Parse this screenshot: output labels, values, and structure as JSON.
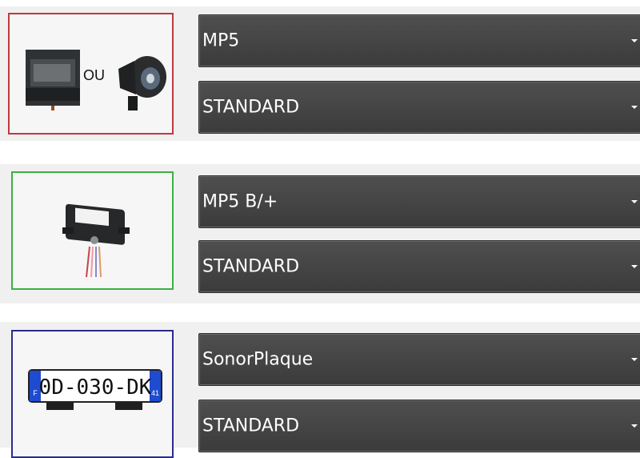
{
  "rows": [
    {
      "image_caption": "OU",
      "model_select": {
        "value": "MP5"
      },
      "mode_select": {
        "value": "STANDARD"
      },
      "border_color": "#c0393f"
    },
    {
      "model_select": {
        "value": "MP5 B/+"
      },
      "mode_select": {
        "value": "STANDARD"
      },
      "border_color": "#3cb043"
    },
    {
      "plate_text": "0D-030-DK",
      "plate_dept": "41",
      "plate_country": "F",
      "model_select": {
        "value": "SonorPlaque"
      },
      "mode_select": {
        "value": "STANDARD"
      },
      "border_color": "#2b2b8f"
    }
  ],
  "icons": {
    "dropdown": "chevron-down-icon"
  }
}
